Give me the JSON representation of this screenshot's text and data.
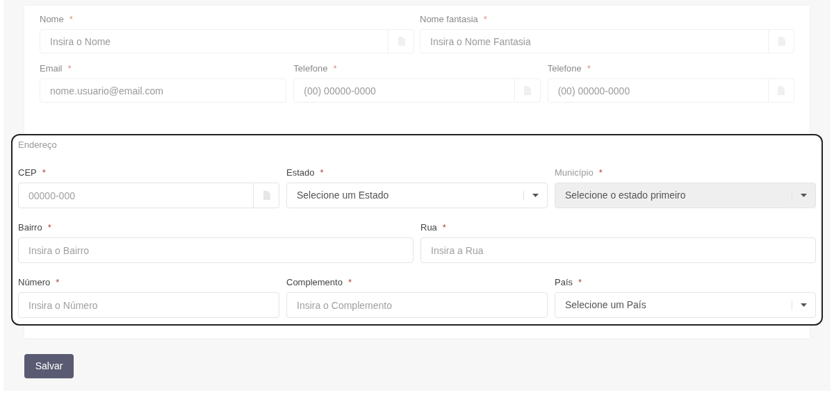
{
  "top_section": {
    "rows": [
      [
        {
          "label": "Nome",
          "required_mark": "*",
          "kind": "addon",
          "placeholder": "Insira o Nome",
          "disabled": false
        },
        {
          "label": "Nome fantasia",
          "required_mark": "*",
          "kind": "addon",
          "placeholder": "Insira o Nome Fantasia",
          "disabled": false
        }
      ],
      [
        {
          "label": "Email",
          "required_mark": "*",
          "kind": "input",
          "placeholder": "nome.usuario@email.com",
          "disabled": false
        },
        {
          "label": "Telefone",
          "required_mark": "*",
          "kind": "addon",
          "placeholder": "(00) 00000-0000",
          "disabled": false
        },
        {
          "label": "Telefone",
          "required_mark": "*",
          "kind": "addon",
          "placeholder": "(00) 00000-0000",
          "disabled": false
        }
      ]
    ]
  },
  "address_section": {
    "title": "Endereço",
    "rows": [
      [
        {
          "label": "CEP",
          "required_mark": "*",
          "kind": "addon",
          "placeholder": "00000-000",
          "disabled": false
        },
        {
          "label": "Estado",
          "required_mark": "*",
          "kind": "select",
          "value": "Selecione um Estado",
          "disabled": false
        },
        {
          "label": "Município",
          "required_mark": "*",
          "kind": "select",
          "value": "Selecione o estado primeiro",
          "disabled": true
        }
      ],
      [
        {
          "label": "Bairro",
          "required_mark": "*",
          "kind": "input",
          "placeholder": "Insira o Bairro",
          "disabled": false
        },
        {
          "label": "Rua",
          "required_mark": "*",
          "kind": "input",
          "placeholder": "Insira a Rua",
          "disabled": false
        }
      ],
      [
        {
          "label": "Número",
          "required_mark": "*",
          "kind": "input",
          "placeholder": "Insira o Número",
          "disabled": false
        },
        {
          "label": "Complemento",
          "required_mark": "*",
          "kind": "input",
          "placeholder": "Insira o Complemento",
          "disabled": false
        },
        {
          "label": "País",
          "required_mark": "*",
          "kind": "select",
          "value": "Selecione um País",
          "disabled": false
        }
      ]
    ]
  },
  "save_button": {
    "label": "Salvar"
  }
}
